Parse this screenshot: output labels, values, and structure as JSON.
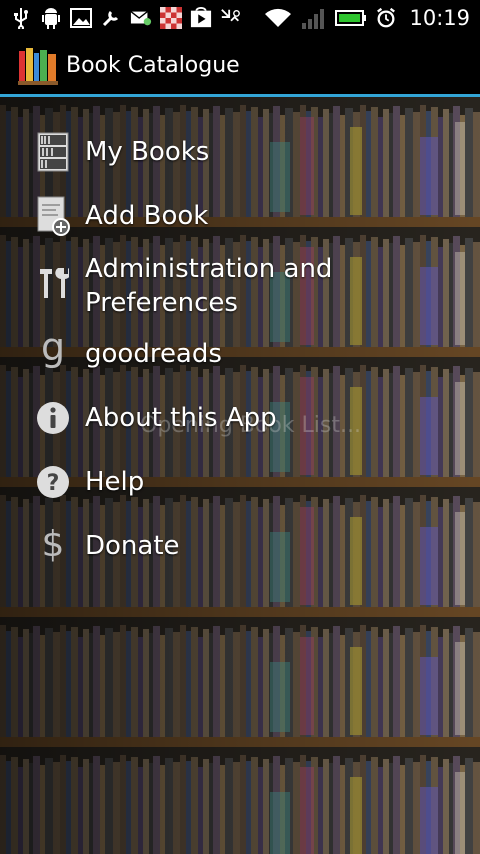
{
  "status_bar": {
    "time": "10:19",
    "left_icons": [
      "usb-icon",
      "android-debug-icon",
      "image-icon",
      "wrench-icon",
      "mail-icon",
      "game-icon",
      "play-store-icon",
      "missed-call-icon"
    ],
    "right_icons": [
      "wifi-icon",
      "signal-icon",
      "battery-icon",
      "alarm-icon"
    ]
  },
  "action_bar": {
    "title": "Book Catalogue",
    "accent_color": "#33a5d6"
  },
  "menu": {
    "items": [
      {
        "label": "My Books",
        "icon": "bookshelf-icon"
      },
      {
        "label": "Add Book",
        "icon": "add-book-icon"
      },
      {
        "label": "Administration and\nPreferences",
        "label_line1": "Administration and",
        "label_line2": "Preferences",
        "icon": "tools-icon"
      },
      {
        "label": "goodreads",
        "icon": "goodreads-icon"
      },
      {
        "label": "About this App",
        "icon": "info-icon"
      },
      {
        "label": "Help",
        "icon": "help-icon"
      },
      {
        "label": "Donate",
        "icon": "dollar-icon"
      }
    ]
  },
  "overlay_hint": "Opening Book List..."
}
